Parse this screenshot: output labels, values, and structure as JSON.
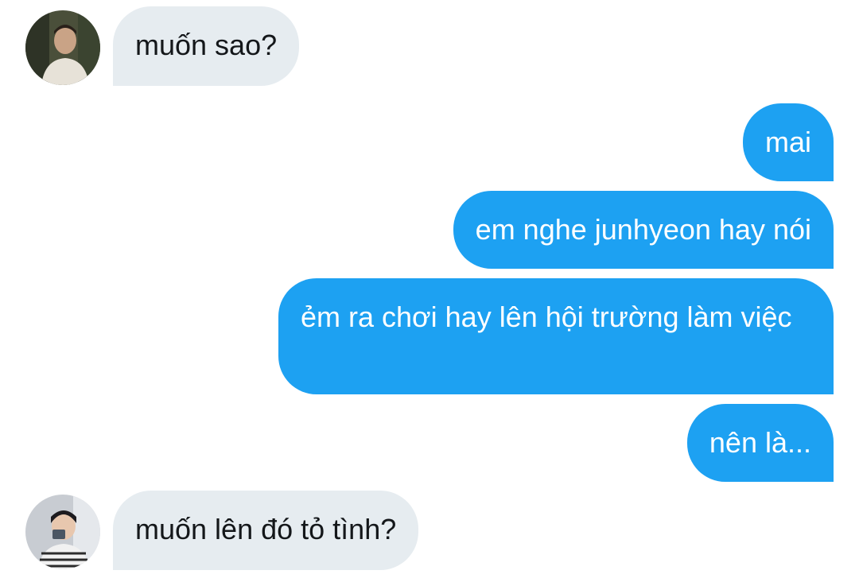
{
  "conversation": {
    "messages": [
      {
        "sender": "contact",
        "text": "muốn sao?"
      },
      {
        "sender": "me",
        "text": "mai"
      },
      {
        "sender": "me",
        "text": "em nghe junhyeon hay nói"
      },
      {
        "sender": "me",
        "text": "ẻm ra chơi hay lên hội trường làm việc"
      },
      {
        "sender": "me",
        "text": "nên là..."
      },
      {
        "sender": "contact",
        "text": "muốn lên đó tỏ tình?"
      }
    ]
  },
  "colors": {
    "incoming_bubble": "#e6ecf0",
    "outgoing_bubble": "#1da1f2",
    "incoming_text": "#14171a",
    "outgoing_text": "#ffffff"
  },
  "avatars": {
    "first": "contact-avatar-photo",
    "second": "contact-avatar-photo-alt"
  }
}
